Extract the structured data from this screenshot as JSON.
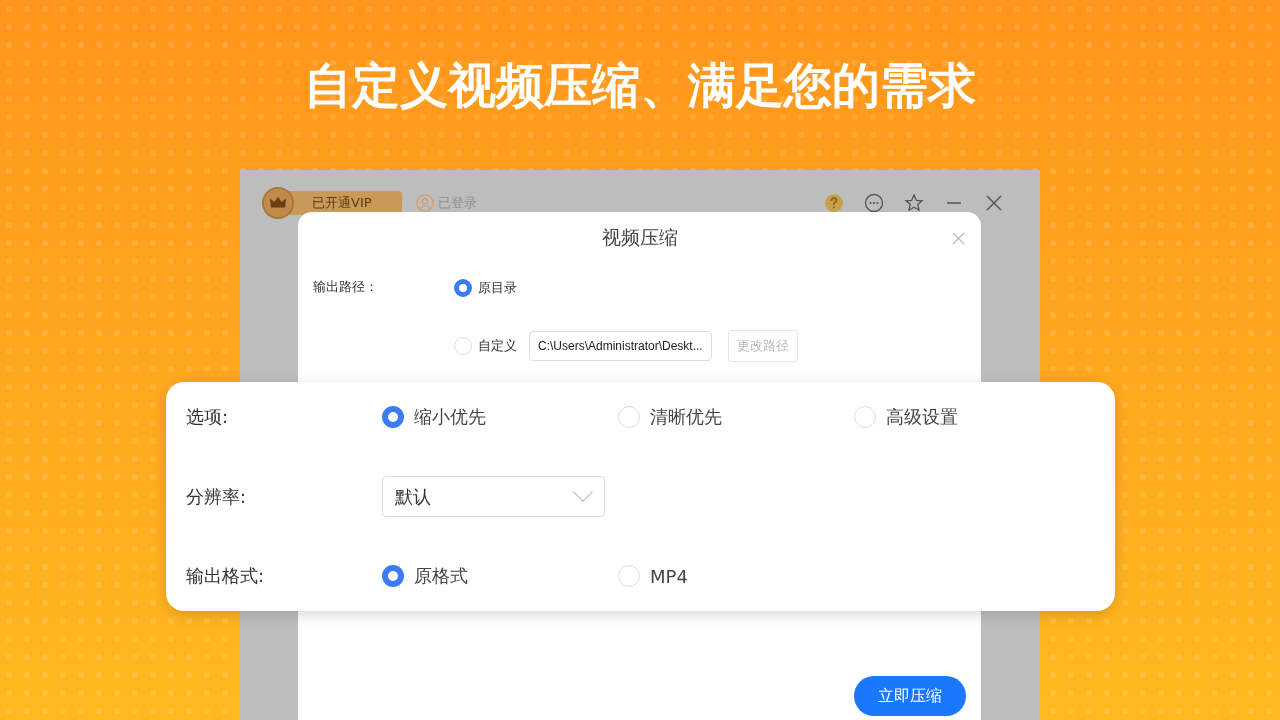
{
  "headline": "自定义视频压缩、满足您的需求",
  "titlebar": {
    "vip_badge": "已开通VIP",
    "login": "已登录"
  },
  "dialog": {
    "title": "视频压缩",
    "output_path": {
      "label": "输出路径：",
      "options": [
        {
          "label": "原目录",
          "selected": true
        },
        {
          "label": "自定义",
          "selected": false
        }
      ],
      "path_value": "C:\\Users\\Administrator\\Deskt...",
      "change_button": {
        "label": "更改路径",
        "disabled": true
      }
    },
    "submit_button": "立即压缩"
  },
  "settings_panel": {
    "rows": [
      {
        "kind": "radio",
        "label": "选项:",
        "options": [
          {
            "label": "缩小优先",
            "selected": true
          },
          {
            "label": "清晰优先",
            "selected": false
          },
          {
            "label": "高级设置",
            "selected": false
          }
        ]
      },
      {
        "kind": "select",
        "label": "分辨率:",
        "value": "默认"
      },
      {
        "kind": "radio",
        "label": "输出格式:",
        "options": [
          {
            "label": "原格式",
            "selected": true
          },
          {
            "label": "MP4",
            "selected": false
          }
        ]
      }
    ]
  }
}
